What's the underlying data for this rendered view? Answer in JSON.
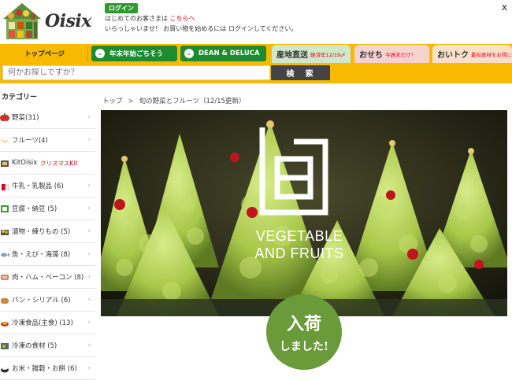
{
  "brand": {
    "name": "Oisix"
  },
  "header": {
    "login_badge": "ログイン",
    "first_time_text": "はじめてのお客さまは",
    "first_time_link": "こちらへ",
    "welcome_prefix": "いらっしゃいませ！ お買い物を始めるには",
    "welcome_link": "ログイン",
    "welcome_suffix": "してください。",
    "close": "x"
  },
  "nav": {
    "tabs": [
      {
        "label": "トップページ"
      },
      {
        "label": "年末年始ごちそう"
      },
      {
        "label": "DEAN & DELUCA"
      },
      {
        "label": "産地直送",
        "note": "経済年12/19〆"
      },
      {
        "label": "おせち",
        "note": "今週末だけ！"
      },
      {
        "label": "おいトク",
        "note": "最旬食材をお得に"
      }
    ]
  },
  "search": {
    "placeholder": "何かお探しですか？",
    "button": "検　索"
  },
  "sidebar": {
    "title": "カテゴリー",
    "items": [
      {
        "label": "野菜(31)",
        "icon": "vegetable-icon"
      },
      {
        "label": "フルーツ(4)",
        "icon": "banana-icon"
      },
      {
        "label": "KitOisix",
        "badge": "クリスマスKit",
        "icon": "kit-icon"
      },
      {
        "label": "牛乳・乳製品 (6)",
        "icon": "milk-icon"
      },
      {
        "label": "豆腐・納豆 (5)",
        "icon": "tofu-icon"
      },
      {
        "label": "漬物・練りもの (5)",
        "icon": "pickles-icon"
      },
      {
        "label": "魚・えび・海藻 (8)",
        "icon": "fish-icon"
      },
      {
        "label": "肉・ハム・ベーコン (8)",
        "icon": "meat-icon"
      },
      {
        "label": "パン・シリアル (6)",
        "icon": "bread-icon"
      },
      {
        "label": "冷凍食品(主食) (13)",
        "icon": "frozen-meal-icon"
      },
      {
        "label": "冷凍の食材 (5)",
        "icon": "frozen-ingredient-icon"
      },
      {
        "label": "お米・雑穀・お餅 (6)",
        "icon": "rice-icon"
      }
    ]
  },
  "breadcrumb": {
    "home": "トップ",
    "separator": ">",
    "current": "旬の野菜とフルーツ（12/15更新）"
  },
  "banner": {
    "kanji": "旬",
    "line1": "VEGETABLE",
    "line2": "AND FRUITS",
    "badge_line1": "入荷",
    "badge_line2": "しました!"
  },
  "colors": {
    "brand_yellow": "#f8ba00",
    "nav_green": "#1f8a2e",
    "accent_red": "#e0001b",
    "badge_green": "#6b9a3a"
  }
}
